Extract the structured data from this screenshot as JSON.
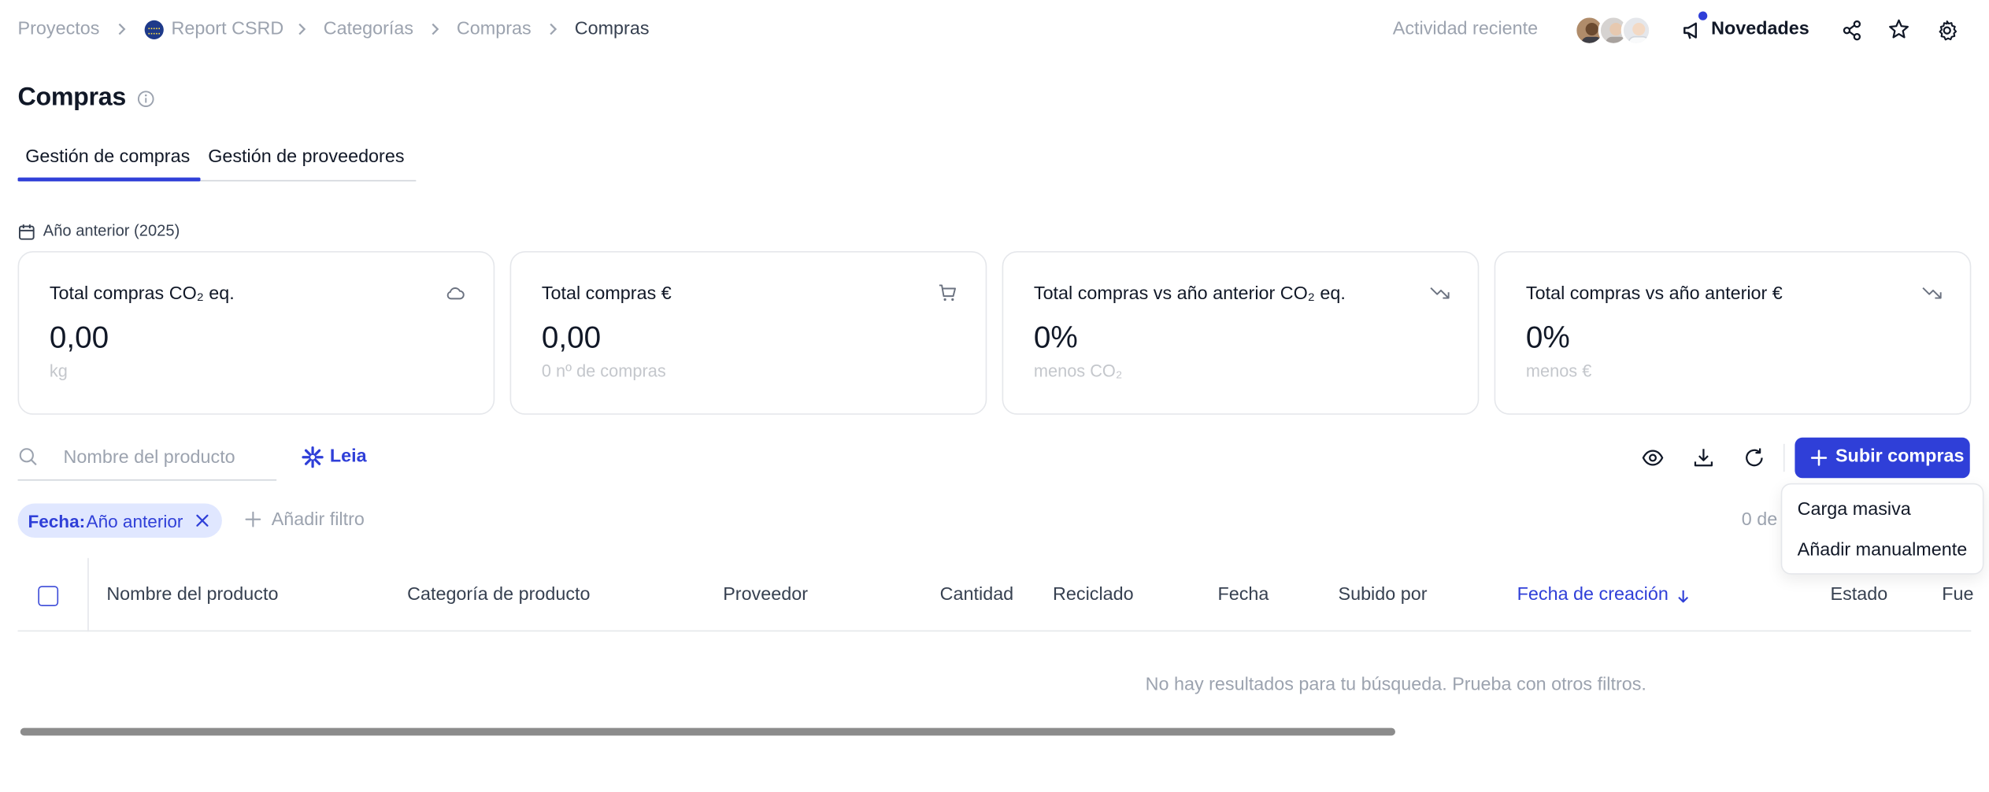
{
  "breadcrumb": {
    "items": [
      "Proyectos",
      "Report CSRD",
      "Categorías",
      "Compras",
      "Compras"
    ]
  },
  "header": {
    "recent_activity": "Actividad reciente",
    "news_label": "Novedades",
    "icons": [
      "megaphone-icon",
      "share-icon",
      "star-icon",
      "gear-icon"
    ]
  },
  "page": {
    "title": "Compras"
  },
  "tabs": [
    {
      "label": "Gestión de compras",
      "active": true
    },
    {
      "label": "Gestión de proveedores",
      "active": false
    }
  ],
  "period": {
    "label": "Año anterior (2025)"
  },
  "kpi_cards": [
    {
      "title": "Total compras CO₂ eq.",
      "value": "0,00",
      "sub": "kg",
      "icon": "cloud-icon"
    },
    {
      "title": "Total compras €",
      "value": "0,00",
      "sub": "0 nº de compras",
      "icon": "cart-icon"
    },
    {
      "title": "Total compras vs año anterior CO₂ eq.",
      "value": "0%",
      "sub": "menos CO₂",
      "icon": "trend-down-icon"
    },
    {
      "title": "Total compras vs año anterior €",
      "value": "0%",
      "sub": "menos €",
      "icon": "trend-down-icon"
    }
  ],
  "toolbar": {
    "search_placeholder": "Nombre del producto",
    "search_value": "",
    "leia_label": "Leia",
    "upload_label": "Subir compras"
  },
  "filters": {
    "chip_key": "Fecha:",
    "chip_value": "Año anterior",
    "add_filter_label": "Añadir filtro",
    "result_count": "0 de"
  },
  "upload_menu": {
    "items": [
      "Carga masiva",
      "Añadir manualmente"
    ]
  },
  "table": {
    "columns": [
      "Nombre del producto",
      "Categoría de producto",
      "Proveedor",
      "Cantidad",
      "Reciclado",
      "Fecha",
      "Subido por",
      "Fecha de creación",
      "Estado",
      "Fue"
    ],
    "sorted_column": "Fecha de creación",
    "empty_message": "No hay resultados para tu búsqueda. Prueba con otros filtros."
  },
  "colors": {
    "accent": "#2f3fd8",
    "chip_bg": "#e0e7ff",
    "muted_text": "#9ca3af"
  }
}
